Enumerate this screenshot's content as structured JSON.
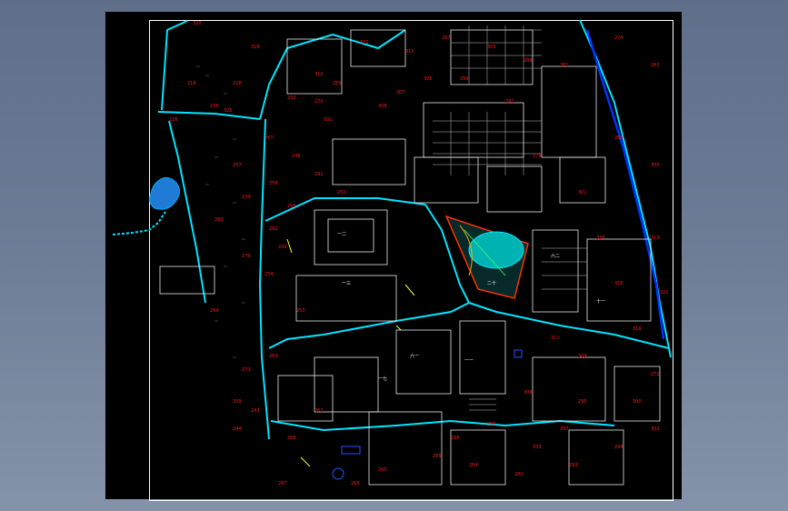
{
  "app": {
    "colors": {
      "background_gradient_top": "#5f6f8a",
      "background_gradient_bottom": "#8593aa",
      "model_space": "#000000",
      "buildings": "#ffffff",
      "roads": "#00e5ff",
      "lot_numbers": "#ff1a1a",
      "water": "#00aaff",
      "park_outline": "#ff3300",
      "park_fill": "#00cccc",
      "stream": "#0033ff",
      "paths": "#ffff33"
    }
  },
  "drawing": {
    "lot_labels": [
      "320",
      "318",
      "312",
      "321",
      "315",
      "297",
      "303",
      "289",
      "281",
      "274",
      "262",
      "325",
      "267",
      "248",
      "257",
      "258",
      "256",
      "233",
      "291",
      "252",
      "283",
      "239",
      "282",
      "250",
      "276",
      "254",
      "331",
      "232",
      "270",
      "263",
      "308",
      "307",
      "305",
      "299",
      "292",
      "279",
      "288",
      "305",
      "301",
      "316",
      "310",
      "322",
      "313",
      "319",
      "309",
      "311",
      "306",
      "287",
      "333",
      "295",
      "300",
      "302",
      "294",
      "293",
      "290",
      "296",
      "285",
      "284",
      "280",
      "265",
      "266",
      "261",
      "268",
      "273",
      "259",
      "264",
      "226",
      "218",
      "236",
      "228",
      "269",
      "243",
      "244",
      "247",
      "271"
    ],
    "block_labels": [
      "一二",
      "六一",
      "一三",
      "一一",
      "二十",
      "六二",
      "一七",
      "十一"
    ]
  }
}
